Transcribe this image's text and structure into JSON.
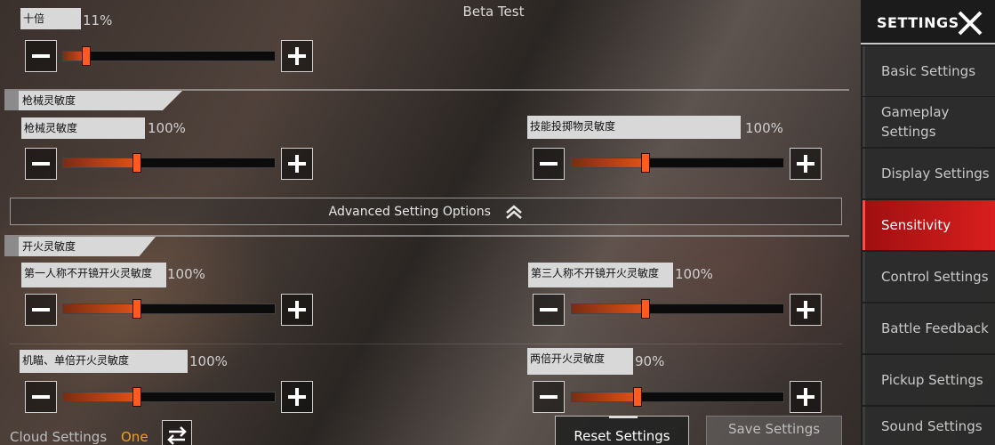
{
  "top_title": "Beta Test",
  "zoom": {
    "label": "十倍",
    "value": "11%",
    "level": 0.11
  },
  "weapon_section": {
    "title": "枪械灵敏度",
    "left": {
      "label": "枪械灵敏度",
      "value": "100%",
      "level": 0.35
    },
    "right": {
      "label": "技能投掷物灵敏度",
      "value": "100%",
      "level": 0.35
    }
  },
  "advanced": {
    "label": "Advanced Setting Options",
    "icon": "chevron-up-icon"
  },
  "fire_section": {
    "title": "开火灵敏度",
    "rows": [
      {
        "left": {
          "label": "第一人称不开镜开火灵敏度",
          "value": "100%",
          "level": 0.35
        },
        "right": {
          "label": "第三人称不开镜开火灵敏度",
          "value": "100%",
          "level": 0.35
        }
      },
      {
        "left": {
          "label": "机瞄、单倍开火灵敏度",
          "value": "100%",
          "level": 0.35
        },
        "right": {
          "label": "两倍开火灵敏度",
          "value": "90%",
          "level": 0.31
        }
      }
    ]
  },
  "bottom": {
    "cloud_label": "Cloud Settings",
    "cloud_value": "One",
    "reset_label": "Reset Settings",
    "save_label": "Save Settings"
  },
  "sidebar": {
    "title": "SETTINGS",
    "items": [
      {
        "label": "Basic Settings",
        "active": false
      },
      {
        "label": "Gameplay Settings",
        "active": false
      },
      {
        "label": "Display Settings",
        "active": false
      },
      {
        "label": "Sensitivity",
        "active": true
      },
      {
        "label": "Control Settings",
        "active": false
      },
      {
        "label": "Battle Feedback",
        "active": false
      },
      {
        "label": "Pickup Settings",
        "active": false
      },
      {
        "label": "Sound Settings",
        "active": false
      }
    ]
  },
  "colors": {
    "accent": "#ff5a1f",
    "active_tab": "#c91b1b",
    "cloud_value": "#f0a020"
  }
}
